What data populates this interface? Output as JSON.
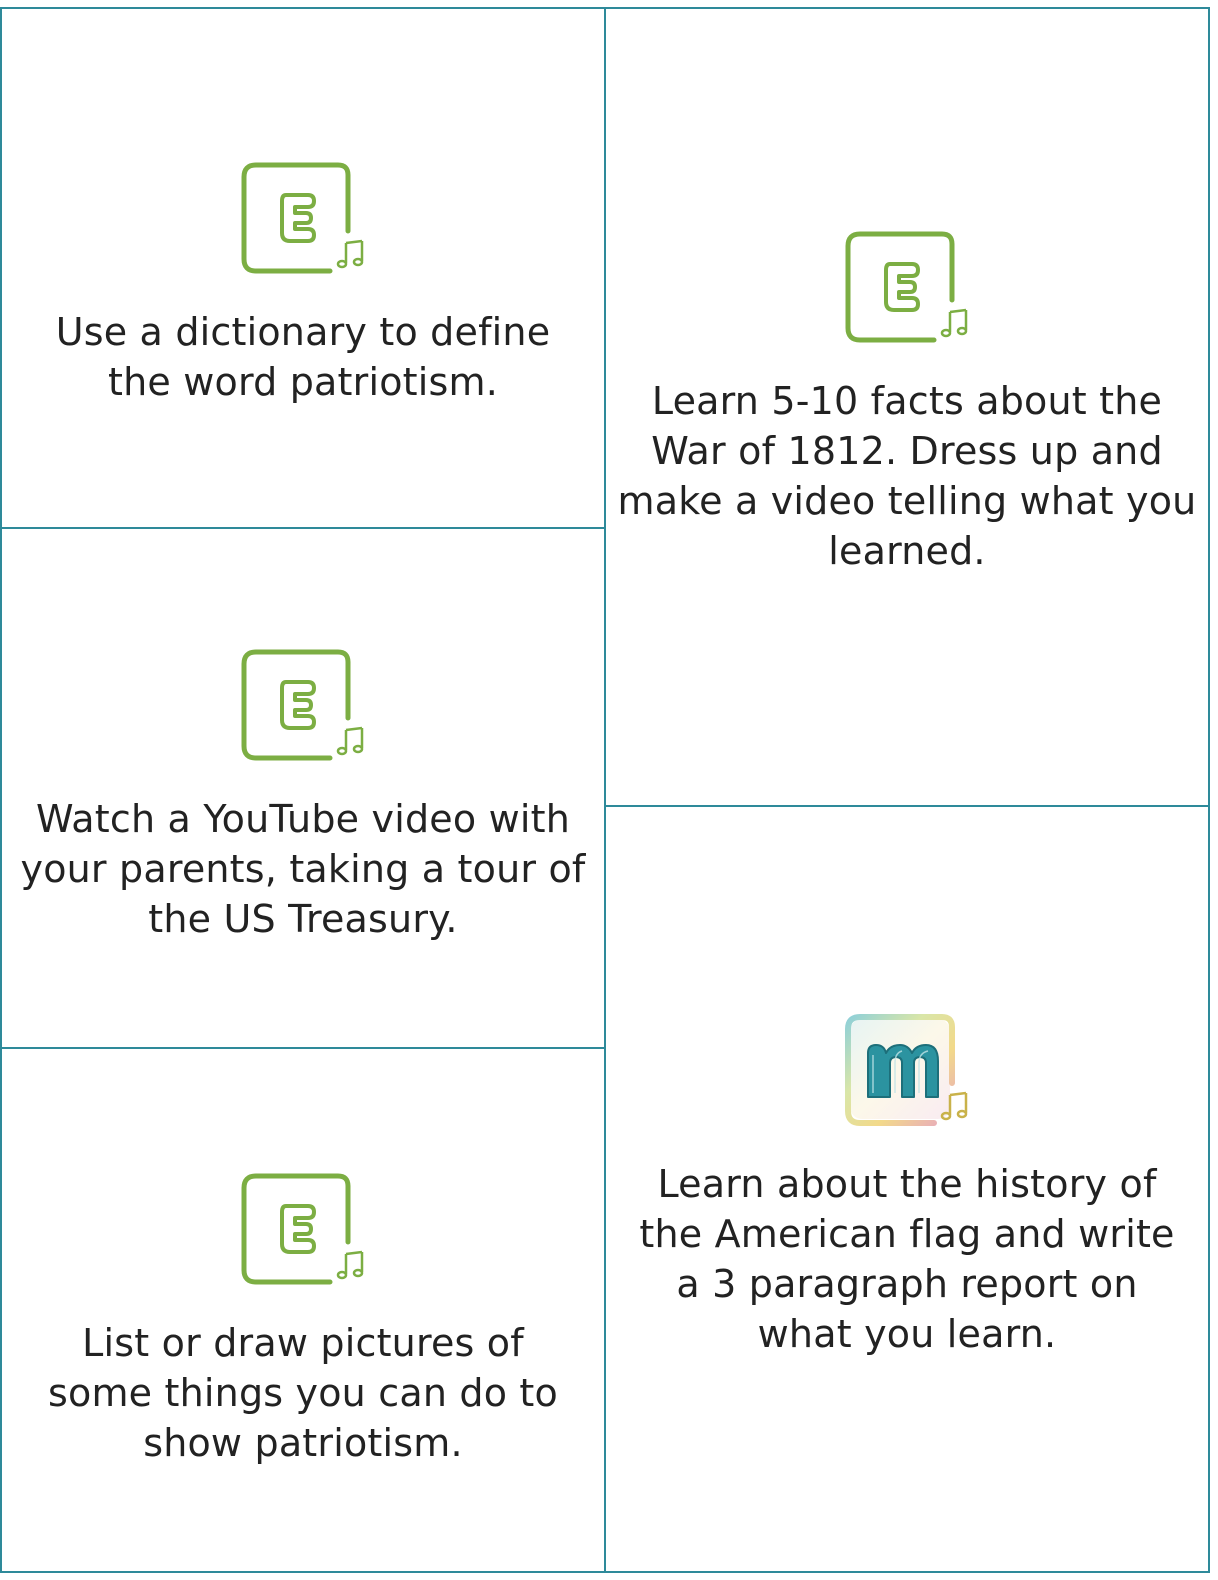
{
  "cards": [
    {
      "icon": "e-music-icon",
      "text": "Use a dictionary to define the word patriotism."
    },
    {
      "icon": "e-music-icon",
      "text": "Watch a YouTube video with your parents, taking a tour of the US Treasury."
    },
    {
      "icon": "e-music-icon",
      "text": "List or draw pictures of some things you can do to show patriotism."
    },
    {
      "icon": "e-music-icon",
      "text": "Learn 5-10 facts about the War of 1812. Dress up and make a video telling what you learned."
    },
    {
      "icon": "m-music-icon",
      "text": "Learn about the history of the American flag and write a 3 paragraph report on what you learn."
    }
  ],
  "colors": {
    "border": "#2e8a9a",
    "e_icon": "#7cae43",
    "m_letter": "#2b93a0",
    "note_gold": "#c9b24a"
  }
}
